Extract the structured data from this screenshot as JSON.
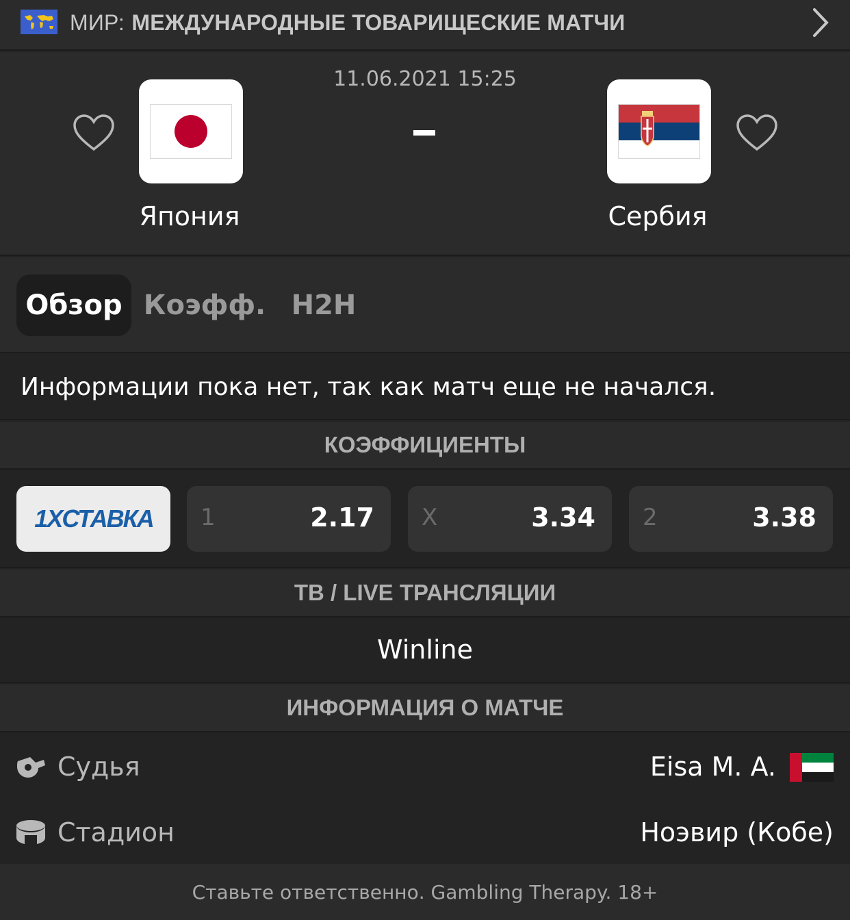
{
  "league": {
    "prefix": "МИР:",
    "name": "МЕЖДУНАРОДНЫЕ ТОВАРИЩЕСКИЕ МАТЧИ",
    "flag_icon": "world-map-flag-icon",
    "chevron_icon": "chevron-right-icon"
  },
  "match": {
    "datetime": "11.06.2021 15:25",
    "score": "-",
    "home": {
      "name": "Япония",
      "logo_icon": "japan-flag-icon",
      "favorite_icon": "heart-outline-icon"
    },
    "away": {
      "name": "Сербия",
      "logo_icon": "serbia-flag-icon",
      "favorite_icon": "heart-outline-icon"
    }
  },
  "tabs": [
    {
      "label": "Обзор",
      "active": true
    },
    {
      "label": "Коэфф.",
      "active": false
    },
    {
      "label": "H2H",
      "active": false
    }
  ],
  "info_message": "Информации пока нет, так как матч еще не начался.",
  "odds_section": {
    "title": "КОЭФФИЦИЕНТЫ",
    "bookmaker": "1XСТАВКА",
    "items": [
      {
        "key": "1",
        "value": "2.17"
      },
      {
        "key": "X",
        "value": "3.34"
      },
      {
        "key": "2",
        "value": "3.38"
      }
    ]
  },
  "tv_section": {
    "title": "ТВ / LIVE ТРАНСЛЯЦИИ",
    "channel": "Winline"
  },
  "match_info": {
    "title": "ИНФОРМАЦИЯ О МАТЧЕ",
    "referee": {
      "label": "Судья",
      "value": "Eisa M. A.",
      "icon": "whistle-icon",
      "flag_icon": "uae-flag-icon"
    },
    "stadium": {
      "label": "Стадион",
      "value": "Ноэвир (Кобе)",
      "icon": "stadium-icon"
    }
  },
  "footer": "Ставьте ответственно. Gambling Therapy. 18+",
  "colors": {
    "background": "#232323",
    "panel": "#2b2b2b",
    "odd_box": "#333333",
    "japan_red": "#bc002d",
    "serbia_red": "#c6363c",
    "serbia_blue": "#0c4076",
    "bookmaker_blue": "#1a5fa8"
  }
}
